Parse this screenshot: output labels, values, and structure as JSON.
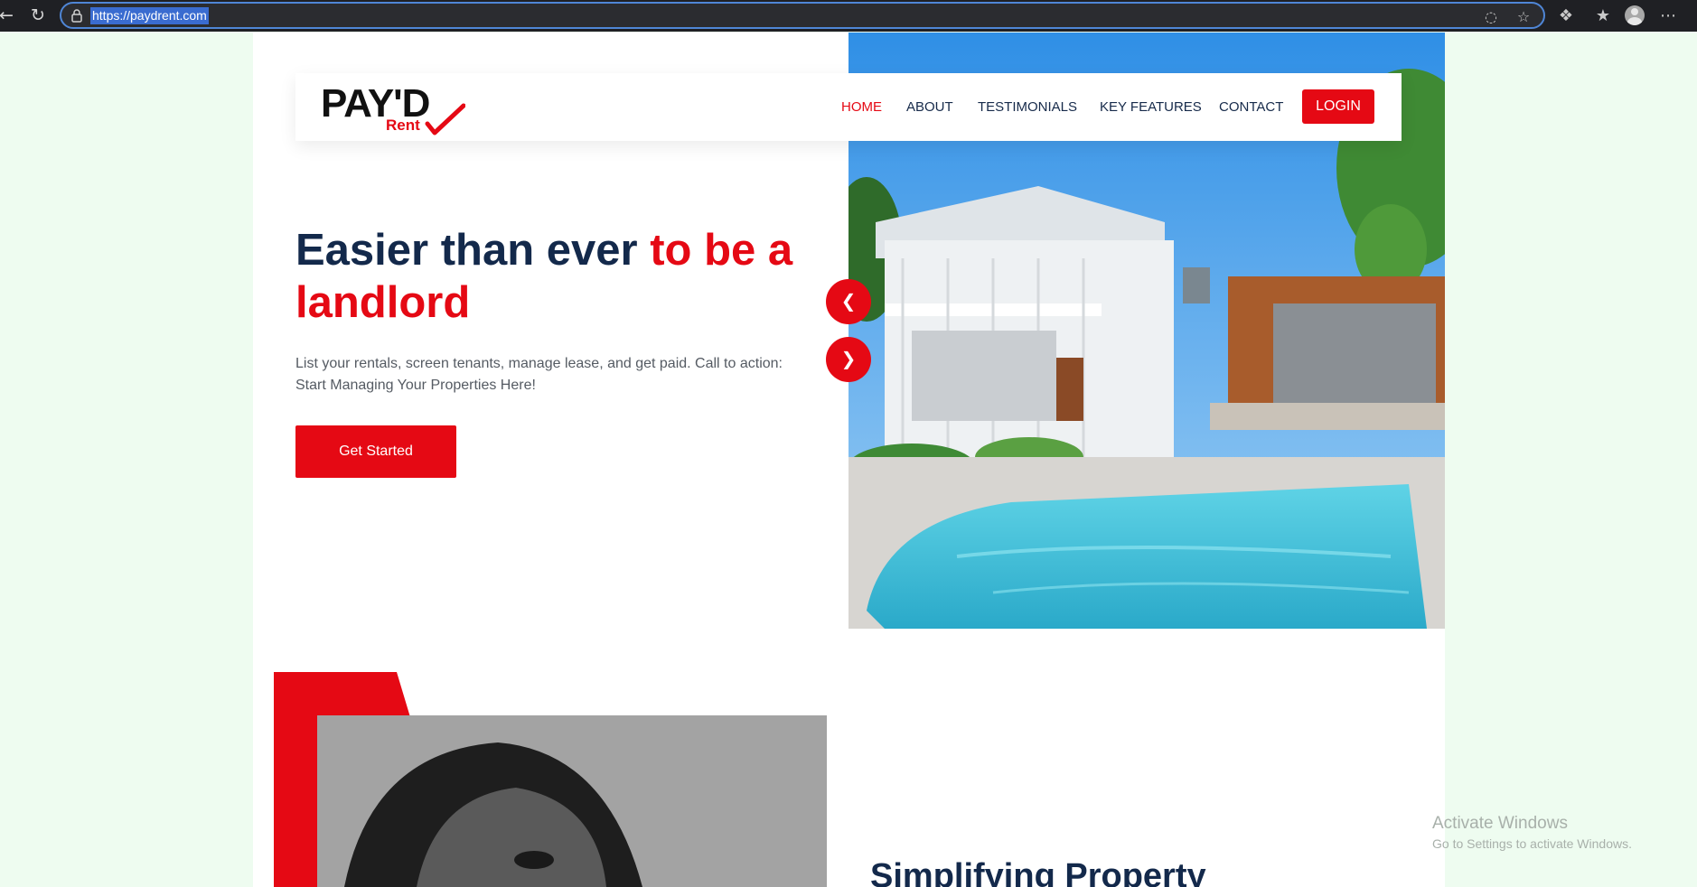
{
  "browser": {
    "url": "https://paydrent.com",
    "back_icon": "back-arrow-icon",
    "refresh_icon": "refresh-icon",
    "lock_icon": "lock-icon",
    "reader_icon": "reader-mode-icon",
    "favorite_icon": "star-icon",
    "extensions_icon": "puzzle-icon",
    "favorites_icon": "favorites-list-icon",
    "profile_icon": "avatar",
    "menu_icon": "more-icon"
  },
  "logo": {
    "word": "PAY'D",
    "sub": "Rent"
  },
  "nav": {
    "items": [
      {
        "label": "HOME",
        "active": true
      },
      {
        "label": "ABOUT",
        "active": false
      },
      {
        "label": "TESTIMONIALS",
        "active": false
      },
      {
        "label": "KEY FEATURES",
        "active": false
      },
      {
        "label": "CONTACT",
        "active": false
      }
    ],
    "login_label": "LOGIN"
  },
  "hero": {
    "headline_dark": "Easier than ever ",
    "headline_red": "to be a landlord",
    "subtext": "List your rentals, screen tenants, manage lease, and get paid. Call to action: Start Managing Your Properties Here!",
    "cta_label": "Get Started",
    "prev_icon": "chevron-left-icon",
    "next_icon": "chevron-right-icon"
  },
  "section2": {
    "title": "Simplifying Property"
  },
  "watermark": {
    "title": "Activate Windows",
    "subtitle": "Go to Settings to activate Windows."
  },
  "colors": {
    "brand_red": "#e50914",
    "navy": "#13294b",
    "page_bg": "#eefcf0"
  }
}
